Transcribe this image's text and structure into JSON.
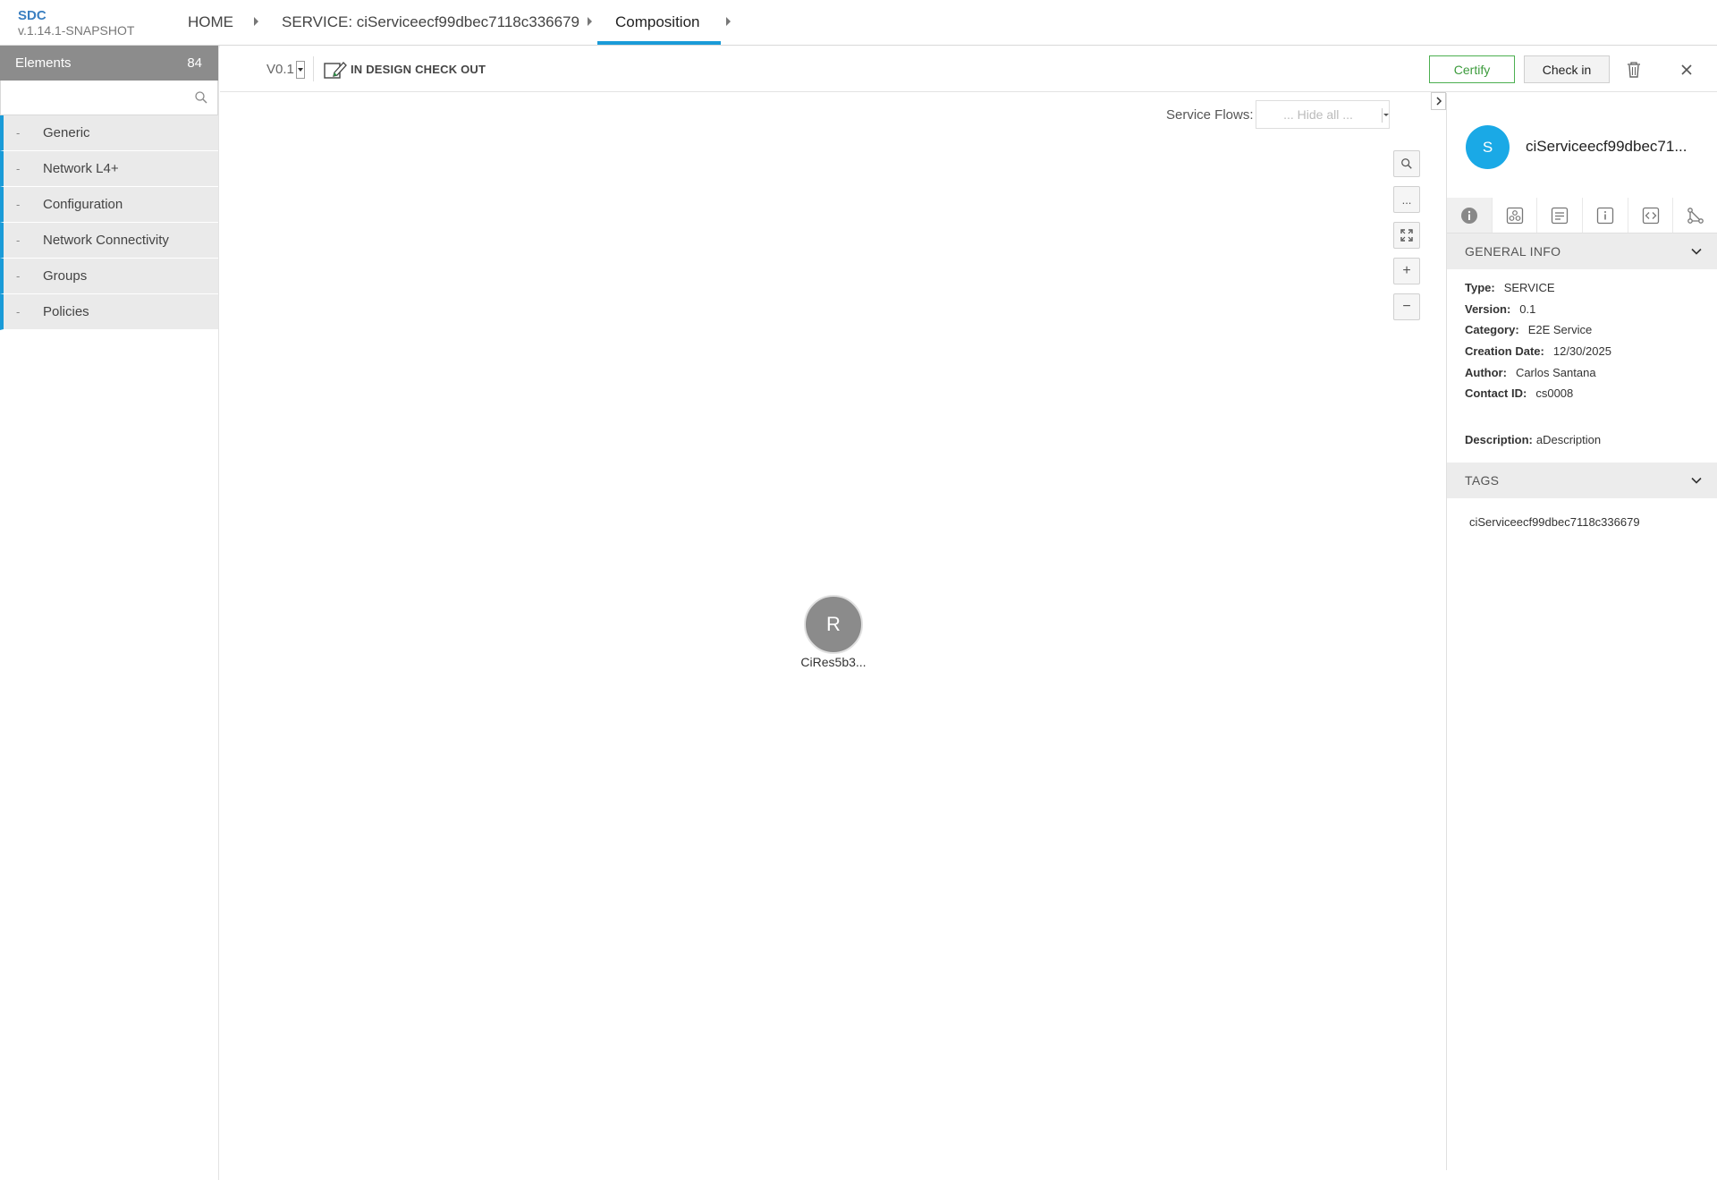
{
  "app": {
    "name": "SDC",
    "version": "v.1.14.1-SNAPSHOT"
  },
  "breadcrumbs": [
    {
      "label": "HOME"
    },
    {
      "label": "SERVICE: ciServiceecf99dbec7118c336679"
    },
    {
      "label": "Composition"
    }
  ],
  "sidebar": {
    "header": "Elements",
    "count": "84",
    "search_placeholder": "",
    "dash": "-",
    "categories": [
      {
        "label": "Generic"
      },
      {
        "label": "Network L4+"
      },
      {
        "label": "Configuration"
      },
      {
        "label": "Network Connectivity"
      },
      {
        "label": "Groups"
      },
      {
        "label": "Policies"
      }
    ]
  },
  "toolbar": {
    "version": "V0.1",
    "status": "IN DESIGN CHECK OUT",
    "certify_label": "Certify",
    "checkin_label": "Check in"
  },
  "canvas": {
    "service_flows_label": "Service Flows:",
    "service_flows_value": "... Hide all ...",
    "zoom_more_label": "...",
    "zoom_in_label": "+",
    "zoom_out_label": "−",
    "node": {
      "letter": "R",
      "label": "CiRes5b3..."
    }
  },
  "panel": {
    "avatar_letter": "S",
    "title": "ciServiceecf99dbec71...",
    "general_info_title": "GENERAL INFO",
    "fields": [
      {
        "key": "Type:",
        "value": "SERVICE"
      },
      {
        "key": "Version:",
        "value": "0.1"
      },
      {
        "key": "Category:",
        "value": "E2E Service"
      },
      {
        "key": "Creation Date:",
        "value": "12/30/2025"
      },
      {
        "key": "Author:",
        "value": "Carlos Santana"
      },
      {
        "key": "Contact ID:",
        "value": "cs0008"
      }
    ],
    "description": {
      "key": "Description:",
      "value": "aDescription"
    },
    "tags_title": "TAGS",
    "tags": [
      "ciServiceecf99dbec7118c336679"
    ]
  },
  "colors": {
    "accent": "#1a9bd8",
    "certify": "#4caf50",
    "avatar": "#1aa9e6",
    "node": "#8b8b8b",
    "sidebar_header": "#8c8c8c"
  }
}
